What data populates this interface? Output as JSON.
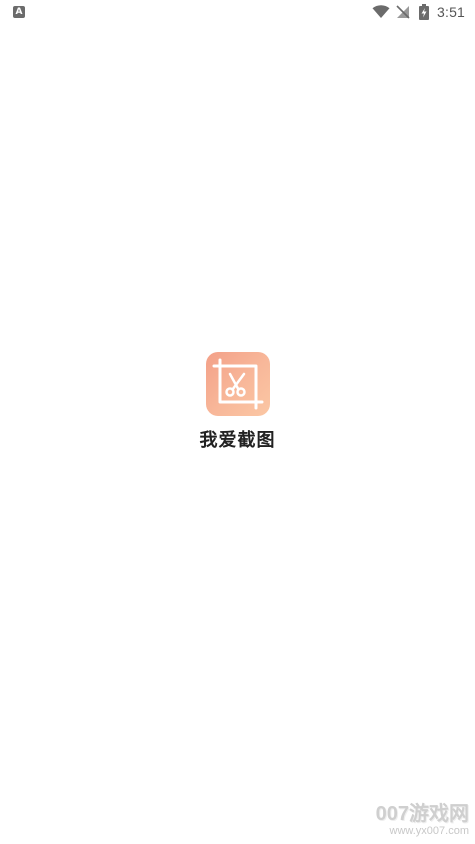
{
  "status_bar": {
    "notification_icon": "font-icon",
    "notification_glyph": "A",
    "wifi_icon": "wifi-icon",
    "signal_icon": "no-signal-icon",
    "battery_icon": "battery-charging-icon",
    "time": "3:51"
  },
  "splash": {
    "logo_icon": "scissors-crop-icon",
    "logo_gradient": [
      "#f3a088",
      "#fbc7a4"
    ],
    "app_name": "我爱截图"
  },
  "watermark": {
    "brand": "007游戏网",
    "url": "www.yx007.com"
  }
}
